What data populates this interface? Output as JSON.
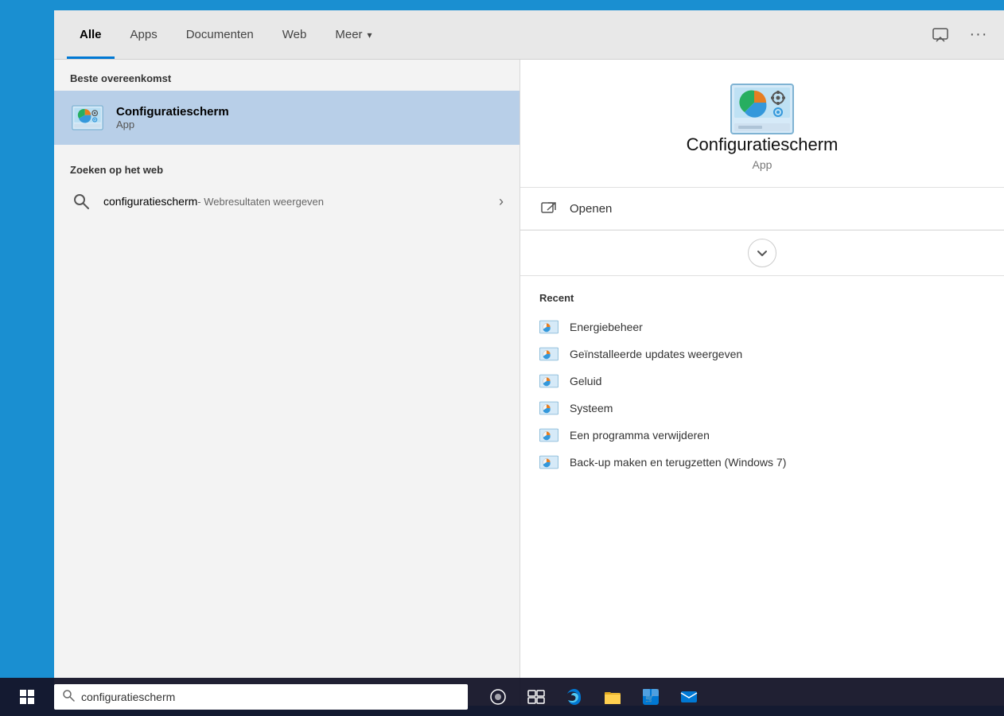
{
  "tabs": {
    "items": [
      {
        "label": "Alle",
        "active": true
      },
      {
        "label": "Apps",
        "active": false
      },
      {
        "label": "Documenten",
        "active": false
      },
      {
        "label": "Web",
        "active": false
      },
      {
        "label": "Meer",
        "active": false
      }
    ]
  },
  "sections": {
    "beste_overeenkomst": "Beste overeenkomst",
    "zoeken_op_het_web": "Zoeken op het web"
  },
  "best_match": {
    "name": "Configuratiescherm",
    "type": "App"
  },
  "web_search": {
    "text": "configuratiescherm",
    "suffix": " - Webresultaten weergeven"
  },
  "detail": {
    "name": "Configuratiescherm",
    "type": "App",
    "actions": [
      {
        "label": "Openen"
      }
    ]
  },
  "recent": {
    "header": "Recent",
    "items": [
      {
        "label": "Energiebeheer"
      },
      {
        "label": "Geïnstalleerde updates weergeven"
      },
      {
        "label": "Geluid"
      },
      {
        "label": "Systeem"
      },
      {
        "label": "Een programma verwijderen"
      },
      {
        "label": "Back-up maken en terugzetten (Windows 7)"
      }
    ]
  },
  "taskbar": {
    "search_value": "configuratiescherm"
  }
}
